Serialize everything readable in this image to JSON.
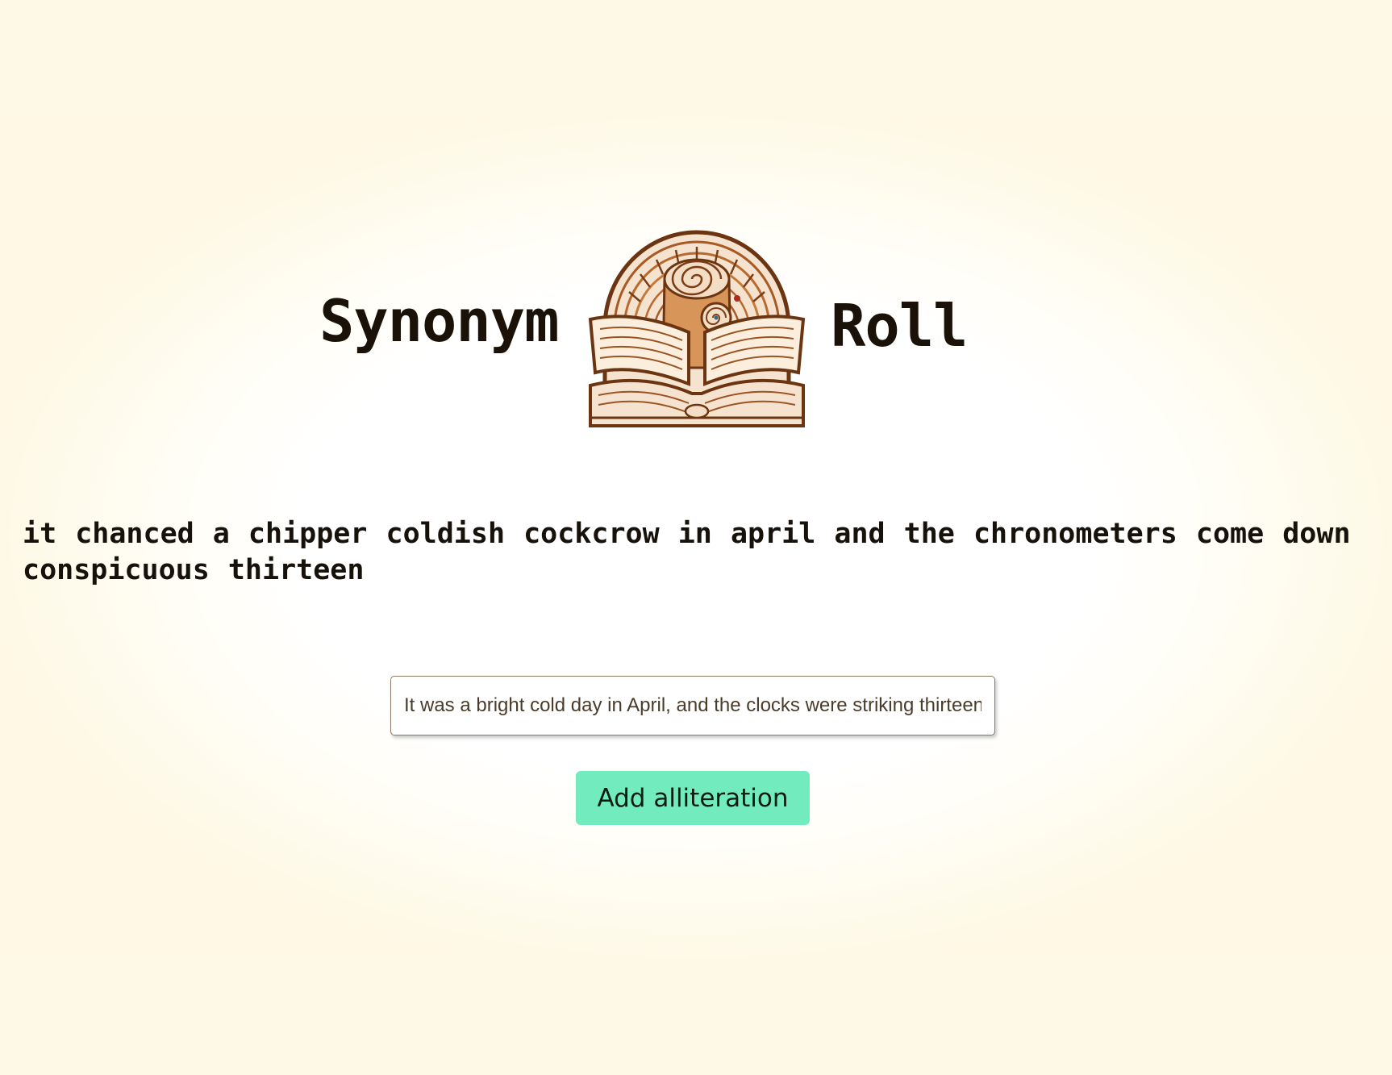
{
  "header": {
    "title_left": "Synonym",
    "title_right": "Roll",
    "logo_icon": "book-cinnamon-roll-logo-icon"
  },
  "output": {
    "text": "it chanced a chipper coldish cockcrow in april and the chronometers come down conspicuous thirteen"
  },
  "input": {
    "value": "It was a bright cold day in April, and the clocks were striking thirteen."
  },
  "button": {
    "label": "Add alliteration"
  },
  "colors": {
    "background": "#fef9e6",
    "button": "#72ecbf",
    "logo_brown": "#8b4a1c"
  }
}
